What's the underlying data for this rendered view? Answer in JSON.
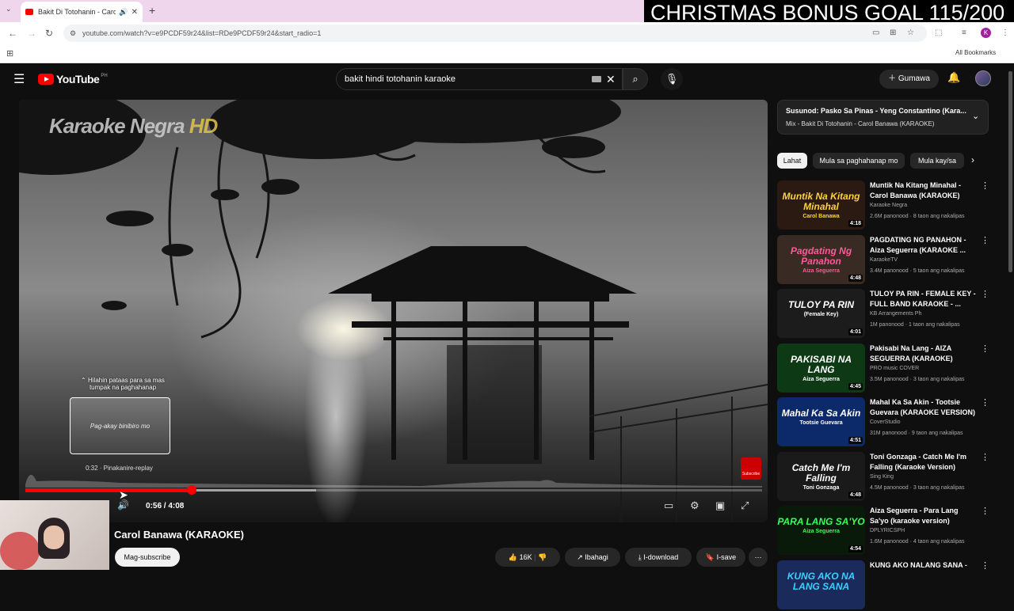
{
  "browser": {
    "tab_title": "Bakit Di Totohanin - Carol B",
    "url": "youtube.com/watch?v=e9PCDF59r24&list=RDe9PCDF59r24&start_radio=1",
    "all_bookmarks": "All Bookmarks",
    "profile_initial": "K"
  },
  "overlay": {
    "text": "CHRISTMAS BONUS GOAL 115/200"
  },
  "header": {
    "logo_text": "YouTube",
    "country_code": "PH",
    "search_value": "bakit hindi totohanin karaoke",
    "create_label": "Gumawa"
  },
  "player": {
    "title_watermark": "Karaoke Negra",
    "title_watermark_hd": "HD",
    "hint": "Hilahin pataas para sa mas tumpak na paghahanap",
    "preview_text": "Pag-akay binibiro mo",
    "preview_time": "0:32 · Pinakanire-replay",
    "time": "0:56 / 4:08",
    "progress": 0.2258,
    "buffered": 0.395,
    "subscribe_watermark": "Subscribe"
  },
  "below": {
    "channel": "Carol Banawa (KARAOKE)",
    "subscribe": "Mag-subscribe",
    "likes": "16K",
    "share": "Ibahagi",
    "download": "I-download",
    "save": "I-save"
  },
  "upnext": {
    "line1": "Susunod: Pasko Sa Pinas - Yeng Constantino (Kara...",
    "line2": "Mix - Bakit Di Totohanin - Carol Banawa (KARAOKE)"
  },
  "chips": [
    "Lahat",
    "Mula sa paghahanap mo",
    "Mula kay/sa"
  ],
  "recs": [
    {
      "thumb": "Muntik Na Kitang Minahal",
      "thumb2": "Carol Banawa",
      "dur": "4:18",
      "title": "Muntik Na Kitang Minahal - Carol Banawa (KARAOKE)",
      "channel": "Karaoke Negra",
      "meta": "2.6M panonood · 8 taon ang nakalipas",
      "bg": "#2a1a12",
      "fg": "#ffd23a"
    },
    {
      "thumb": "Pagdating Ng Panahon",
      "thumb2": "Aiza Seguerra",
      "dur": "4:48",
      "title": "PAGDATING NG PANAHON - Aiza Seguerra (KARAOKE ...",
      "channel": "KaraokeTV",
      "meta": "3.4M panonood · 5 taon ang nakalipas",
      "bg": "#3a2a24",
      "fg": "#ff5a9a"
    },
    {
      "thumb": "TULOY PA RIN",
      "thumb2": "(Female Key)",
      "dur": "4:01",
      "title": "TULOY PA RIN - FEMALE KEY - FULL BAND KARAOKE - ...",
      "channel": "KB Arrangements Ph",
      "meta": "1M panonood · 1 taon ang nakalipas",
      "bg": "#1c1c1c",
      "fg": "#ffffff"
    },
    {
      "thumb": "PAKISABI NA LANG",
      "thumb2": "Aiza Seguerra",
      "dur": "4:45",
      "title": "Pakisabi Na Lang - AIZA SEGUERRA (KARAOKE)",
      "channel": "PRO music COVER",
      "meta": "3.5M panonood · 3 taon ang nakalipas",
      "bg": "#0d3a14",
      "fg": "#ffffff"
    },
    {
      "thumb": "Mahal Ka Sa Akin",
      "thumb2": "Tootsie Guevara",
      "dur": "4:51",
      "title": "Mahal Ka Sa Akin - Tootsie Guevara (KARAOKE VERSION)",
      "channel": "CoverStudio",
      "meta": "31M panonood · 9 taon ang nakalipas",
      "bg": "#0c2a6a",
      "fg": "#ffffff"
    },
    {
      "thumb": "Catch Me I'm Falling",
      "thumb2": "Toni Gonzaga",
      "dur": "4:48",
      "title": "Toni Gonzaga - Catch Me I'm Falling (Karaoke Version)",
      "channel": "Sing King",
      "meta": "4.5M panonood · 3 taon ang nakalipas",
      "bg": "#1a1a1a",
      "fg": "#ffffff"
    },
    {
      "thumb": "PARA LANG SA'YO",
      "thumb2": "Aiza Seguerra",
      "dur": "4:54",
      "title": "Aiza Seguerra - Para Lang Sa'yo (karaoke version)",
      "channel": "DPLYRICSPH",
      "meta": "1.6M panonood · 4 taon ang nakalipas",
      "bg": "#0a1a0a",
      "fg": "#3aff5a"
    },
    {
      "thumb": "KUNG AKO NA LANG SANA",
      "thumb2": "",
      "dur": "",
      "title": "KUNG AKO NALANG SANA -",
      "channel": "",
      "meta": "",
      "bg": "#1a2a5a",
      "fg": "#3ad0ff"
    }
  ]
}
